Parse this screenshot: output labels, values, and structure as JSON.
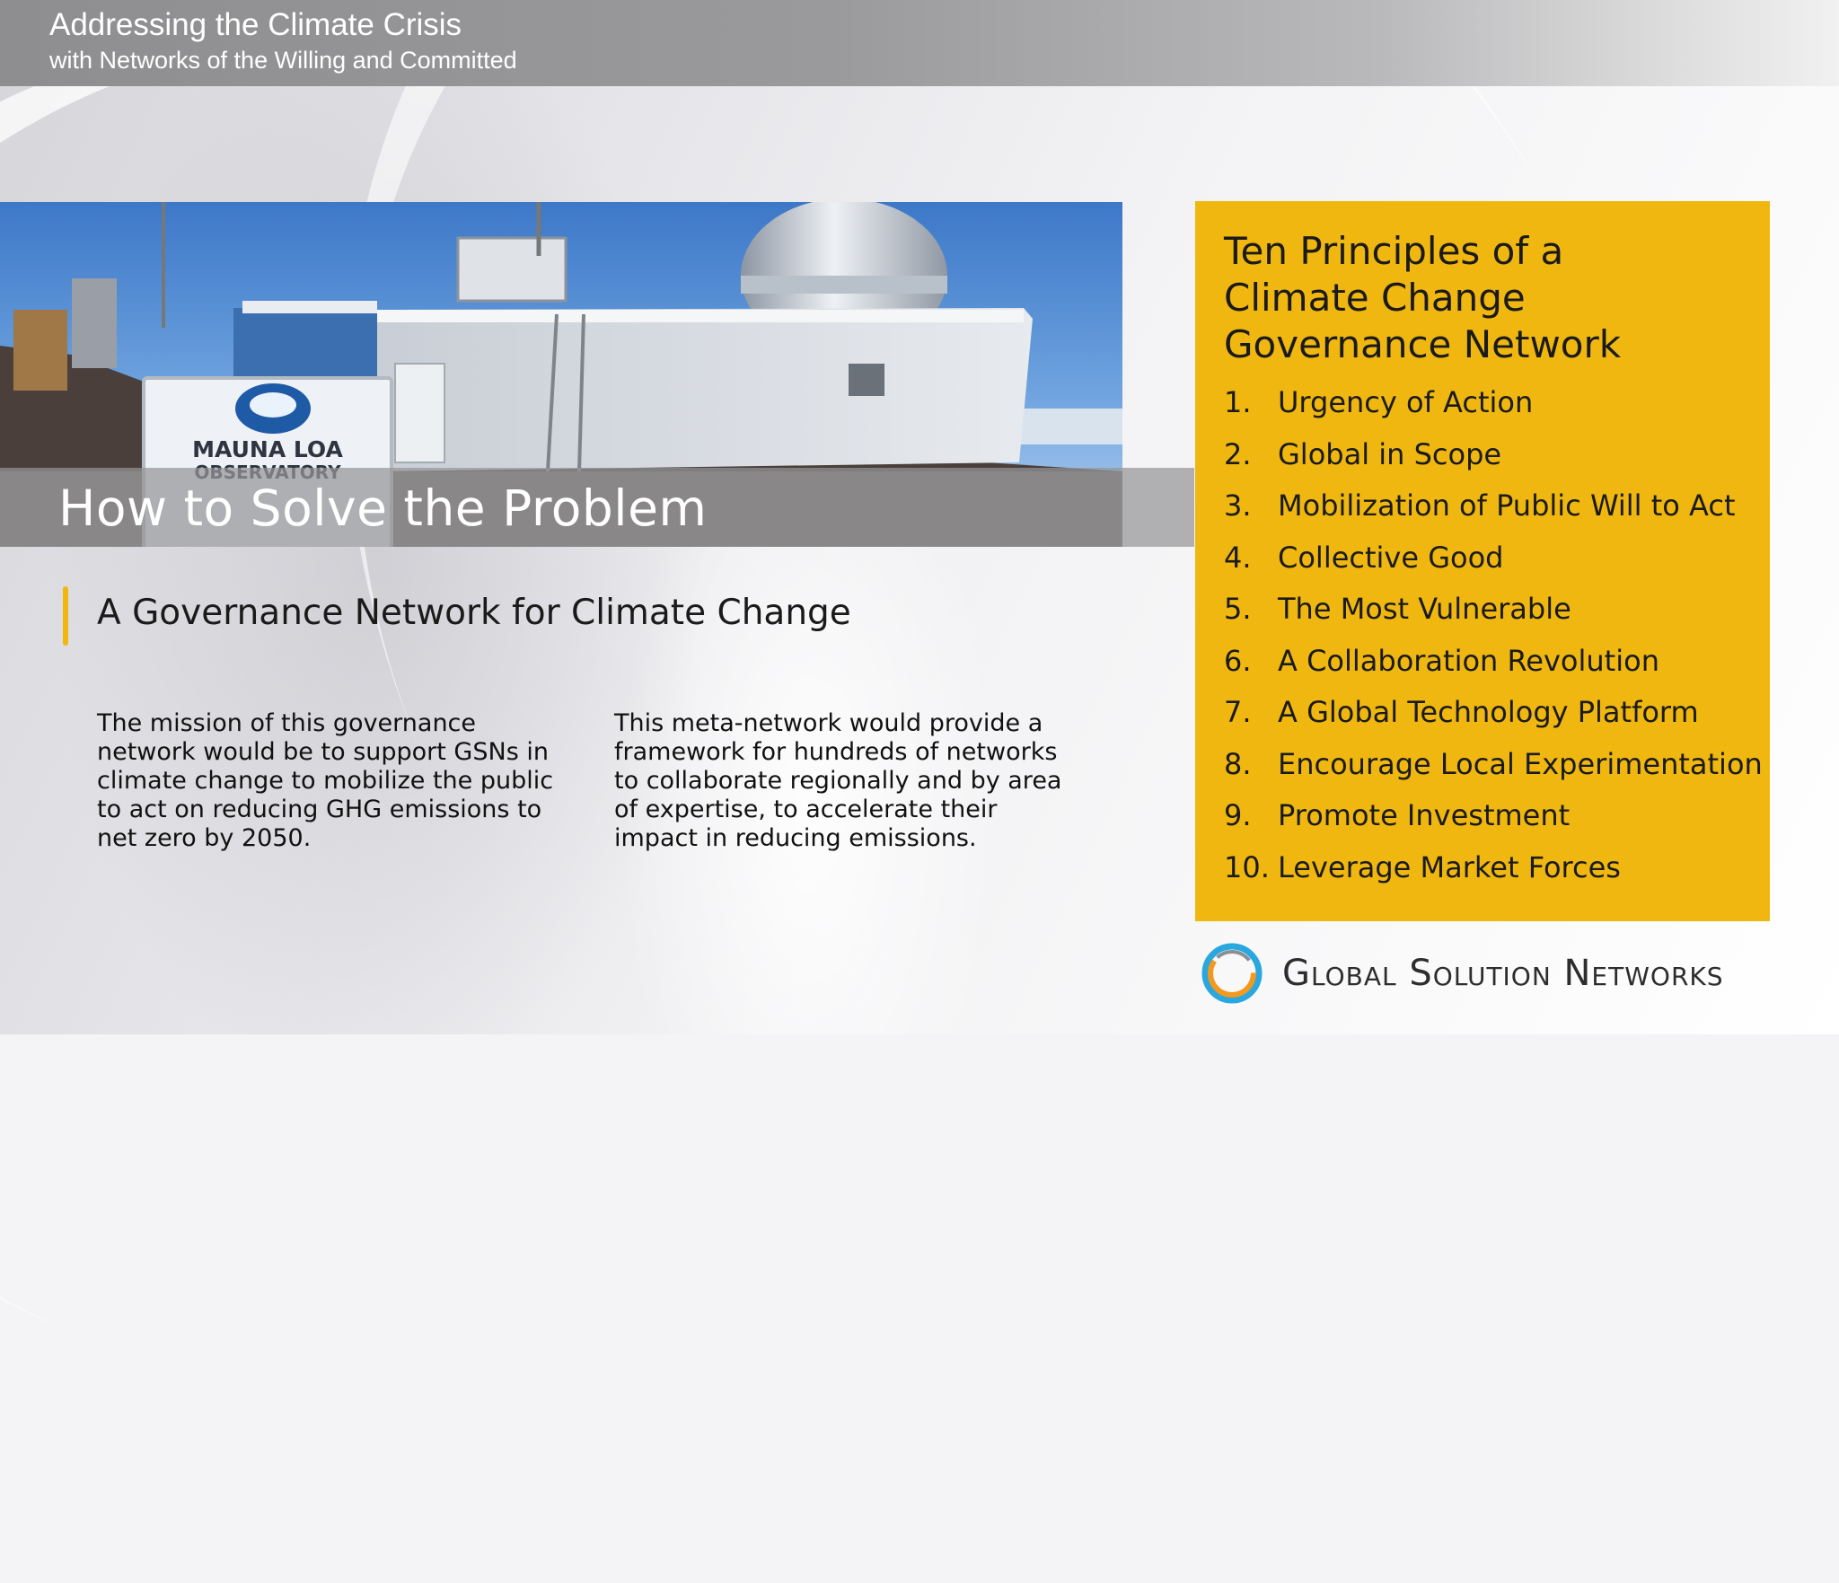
{
  "header": {
    "title": "Addressing the Climate Crisis",
    "subtitle": "with Networks of the Willing and Committed"
  },
  "photo": {
    "sign_line1": "MAUNA LOA",
    "sign_line2": "OBSERVATORY",
    "title": "How to Solve the Problem"
  },
  "section": {
    "heading": "A Governance Network for Climate Change",
    "paragraph_left": "The mission of this governance network would be to support GSNs in climate change to mobilize the public to act on reducing GHG emissions to net zero by 2050.",
    "paragraph_right": "This meta-network would provide a framework for hundreds of networks to collaborate regionally and by area of expertise, to accelerate their impact in reducing emissions."
  },
  "principles": {
    "title": "Ten Principles of a\nClimate Change\nGovernance Network",
    "items": [
      {
        "num": "1.",
        "label": "Urgency of Action"
      },
      {
        "num": "2.",
        "label": "Global in Scope"
      },
      {
        "num": "3.",
        "label": "Mobilization of Public Will to Act"
      },
      {
        "num": "4.",
        "label": "Collective Good"
      },
      {
        "num": "5.",
        "label": "The Most Vulnerable"
      },
      {
        "num": "6.",
        "label": "A Collaboration Revolution"
      },
      {
        "num": "7.",
        "label": "A Global Technology Platform"
      },
      {
        "num": "8.",
        "label": "Encourage Local Experimentation"
      },
      {
        "num": "9.",
        "label": "Promote Investment"
      },
      {
        "num": "10.",
        "label": "Leverage Market Forces"
      }
    ]
  },
  "logo": {
    "text": "Global Solution Networks",
    "icon": "ring-logo-icon"
  },
  "colors": {
    "accent": "#efb70f",
    "header_band": "#9a9a9c"
  }
}
